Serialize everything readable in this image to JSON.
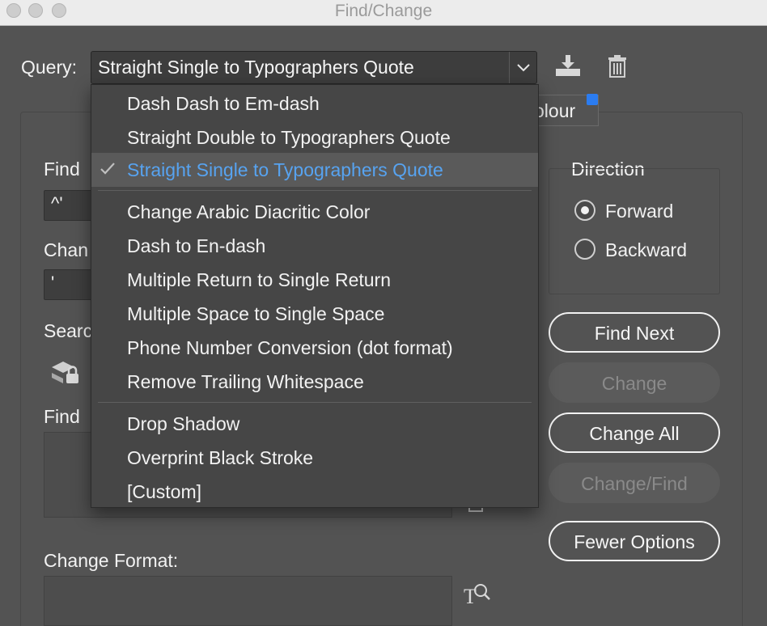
{
  "window": {
    "title": "Find/Change"
  },
  "query": {
    "label": "Query:",
    "selected": "Straight Single to Typographers Quote"
  },
  "menu": {
    "groups": [
      [
        "Dash Dash to Em-dash",
        "Straight Double to Typographers Quote",
        "Straight Single to Typographers Quote"
      ],
      [
        "Change Arabic Diacritic Color",
        "Dash to En-dash",
        "Multiple Return to Single Return",
        "Multiple Space to Single Space",
        "Phone Number Conversion (dot format)",
        "Remove Trailing Whitespace"
      ],
      [
        "Drop Shadow",
        "Overprint Black Stroke",
        "[Custom]"
      ]
    ],
    "selected_item": "Straight Single to Typographers Quote"
  },
  "tabs": {
    "partial_label": "olour"
  },
  "form": {
    "find_label": "Find",
    "find_value": "^'",
    "change_label": "Chan",
    "change_value": "'",
    "search_label": "Searc",
    "find_format_label": "Find",
    "change_format_label": "Change Format:"
  },
  "direction": {
    "title": "Direction",
    "options": [
      "Forward",
      "Backward"
    ],
    "selected": "Forward"
  },
  "buttons": {
    "find_next": "Find Next",
    "change": "Change",
    "change_all": "Change All",
    "change_find": "Change/Find",
    "fewer_options": "Fewer Options"
  },
  "colors": {
    "accent": "#57a3f0",
    "tab_marker": "#2b7cf0",
    "background": "#535353"
  }
}
